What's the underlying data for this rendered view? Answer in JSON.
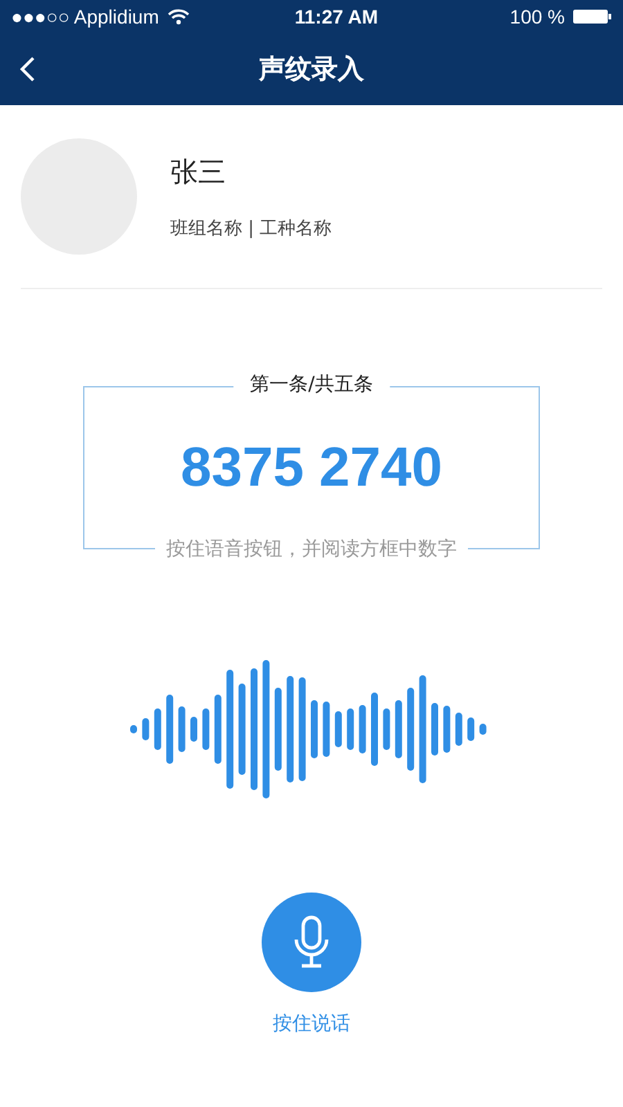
{
  "status_bar": {
    "carrier": "●●●○○ Applidium",
    "time": "11:27 AM",
    "battery": "100 %"
  },
  "nav": {
    "title": "声纹录入"
  },
  "profile": {
    "name": "张三",
    "subtitle": "班组名称 | 工种名称"
  },
  "prompt": {
    "counter": "第一条/共五条",
    "digits": "8375 2740",
    "hint": "按住语音按钮，并阅读方框中数字"
  },
  "record": {
    "label": "按住说话"
  }
}
